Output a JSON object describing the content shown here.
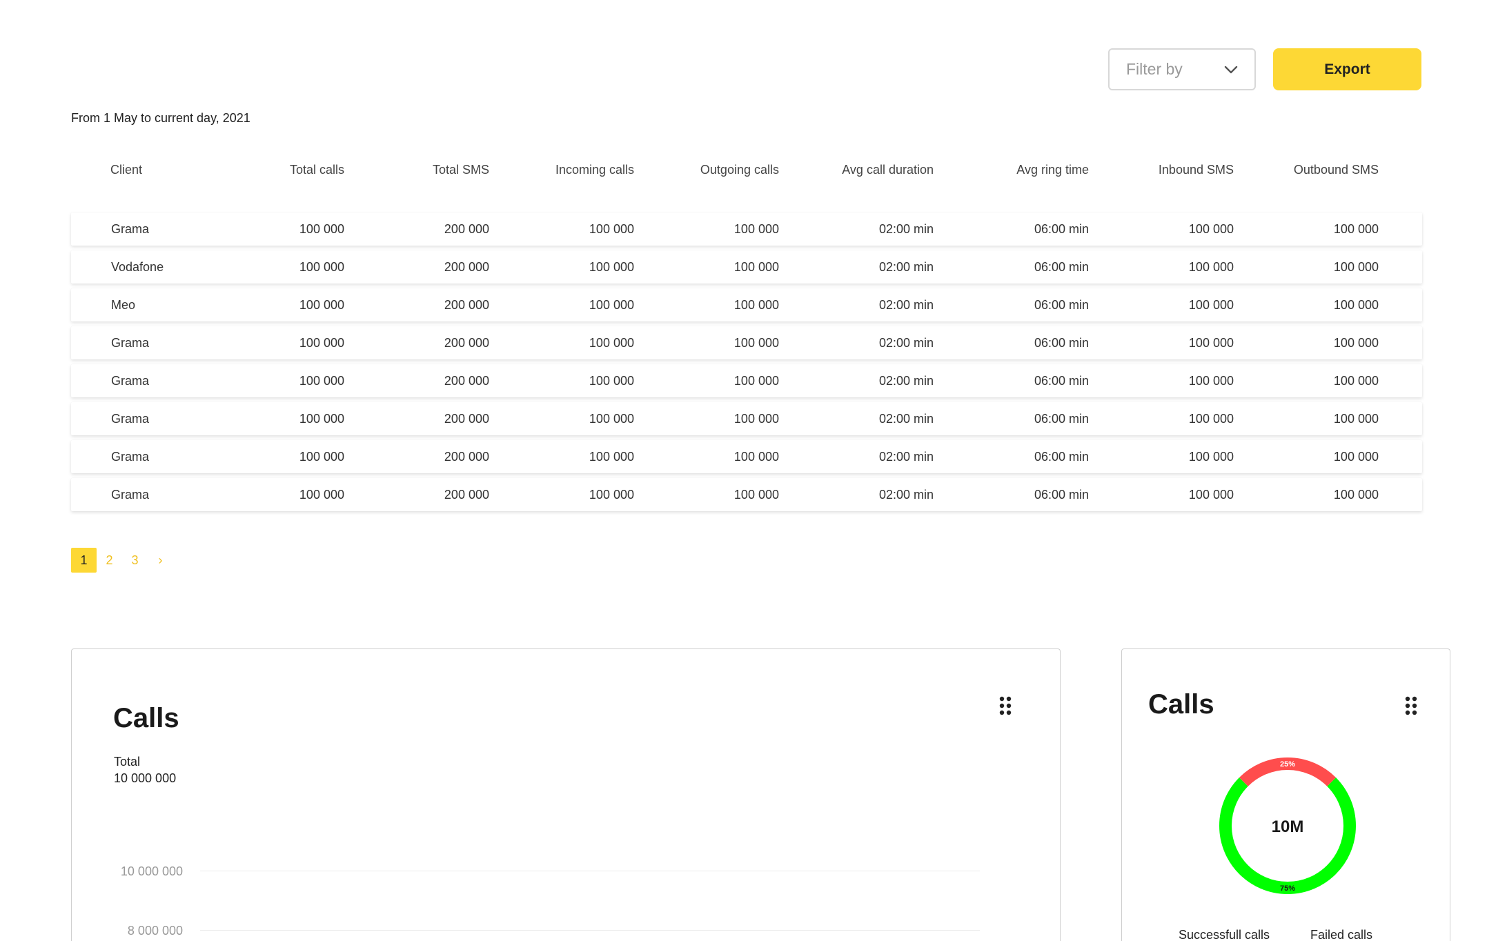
{
  "toolbar": {
    "filter_placeholder": "Filter by",
    "export_label": "Export"
  },
  "date_range": "From 1 May to current day, 2021",
  "table": {
    "headers": [
      "Client",
      "Total calls",
      "Total SMS",
      "Incoming calls",
      "Outgoing calls",
      "Avg call duration",
      "Avg ring time",
      "Inbound SMS",
      "Outbound SMS"
    ],
    "rows": [
      [
        "Grama",
        "100 000",
        "200 000",
        "100 000",
        "100 000",
        "02:00 min",
        "06:00 min",
        "100 000",
        "100 000"
      ],
      [
        "Vodafone",
        "100 000",
        "200 000",
        "100 000",
        "100 000",
        "02:00 min",
        "06:00 min",
        "100 000",
        "100 000"
      ],
      [
        "Meo",
        "100 000",
        "200 000",
        "100 000",
        "100 000",
        "02:00 min",
        "06:00 min",
        "100 000",
        "100 000"
      ],
      [
        "Grama",
        "100 000",
        "200 000",
        "100 000",
        "100 000",
        "02:00 min",
        "06:00 min",
        "100 000",
        "100 000"
      ],
      [
        "Grama",
        "100 000",
        "200 000",
        "100 000",
        "100 000",
        "02:00 min",
        "06:00 min",
        "100 000",
        "100 000"
      ],
      [
        "Grama",
        "100 000",
        "200 000",
        "100 000",
        "100 000",
        "02:00 min",
        "06:00 min",
        "100 000",
        "100 000"
      ],
      [
        "Grama",
        "100 000",
        "200 000",
        "100 000",
        "100 000",
        "02:00 min",
        "06:00 min",
        "100 000",
        "100 000"
      ],
      [
        "Grama",
        "100 000",
        "200 000",
        "100 000",
        "100 000",
        "02:00 min",
        "06:00 min",
        "100 000",
        "100 000"
      ]
    ]
  },
  "pagination": {
    "current": "1",
    "pages": [
      "1",
      "2",
      "3"
    ],
    "next": "›"
  },
  "calls_card": {
    "title": "Calls",
    "total_label": "Total",
    "total_value": "10 000 000",
    "y_ticks": [
      "10 000 000",
      "8 000 000"
    ]
  },
  "calls_donut_card": {
    "title": "Calls",
    "center_label": "10M",
    "segments": [
      {
        "label": "Successfull calls",
        "percent": 75,
        "percent_label": "75%",
        "color": "#00ff00"
      },
      {
        "label": "Failed calls",
        "percent": 25,
        "percent_label": "25%",
        "color": "#ff4d4d"
      }
    ]
  },
  "colors": {
    "accent": "#fdd835",
    "success": "#00ff00",
    "failure": "#ff4d4d"
  }
}
